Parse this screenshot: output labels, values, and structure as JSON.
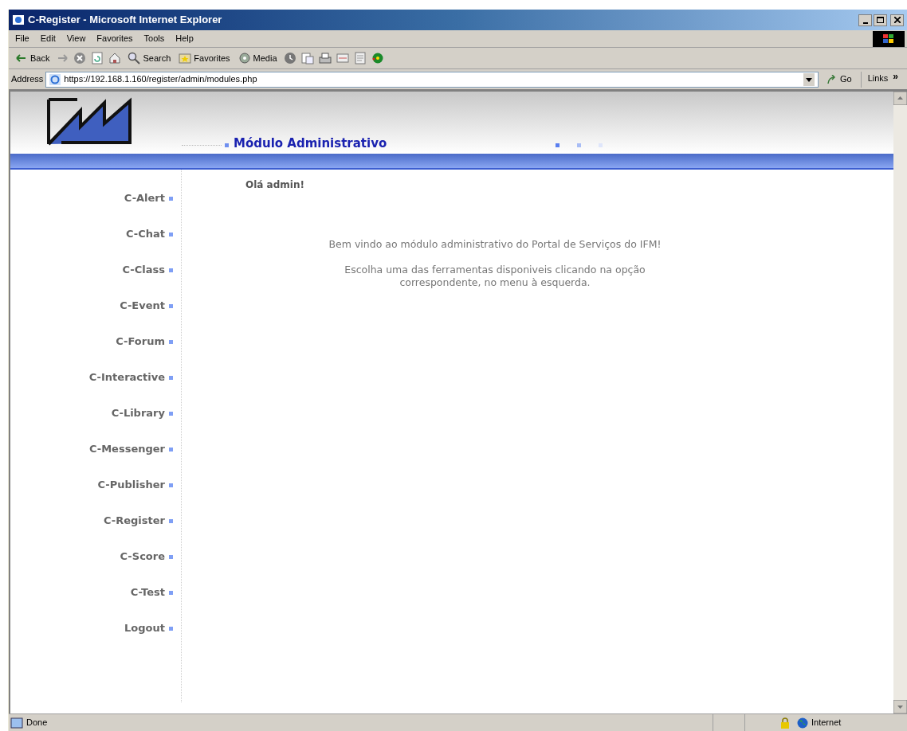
{
  "window": {
    "title": "C-Register - Microsoft Internet Explorer"
  },
  "menu": [
    "File",
    "Edit",
    "View",
    "Favorites",
    "Tools",
    "Help"
  ],
  "toolbar": [
    {
      "kind": "back",
      "label": "Back"
    },
    {
      "kind": "forward"
    },
    {
      "kind": "stop"
    },
    {
      "kind": "refresh"
    },
    {
      "kind": "home"
    },
    {
      "kind": "search",
      "label": "Search"
    },
    {
      "kind": "favorites",
      "label": "Favorites"
    },
    {
      "kind": "media",
      "label": "Media"
    },
    {
      "kind": "history"
    },
    {
      "kind": "mail"
    },
    {
      "kind": "print"
    },
    {
      "kind": "edit"
    },
    {
      "kind": "discuss"
    },
    {
      "kind": "messenger"
    }
  ],
  "address": {
    "label": "Address",
    "value": "https://192.168.1.160/register/admin/modules.php",
    "go": "Go",
    "links": "Links",
    "more": "»"
  },
  "page": {
    "header": "Módulo Administrativo",
    "greeting": "Olá admin!",
    "welcome": [
      "Bem vindo ao módulo administrativo do Portal de Serviços do IFM!",
      "Escolha uma das ferramentas disponiveis clicando na opção correspondente, no menu à esquerda."
    ],
    "menu": [
      "C-Alert",
      "C-Chat",
      "C-Class",
      "C-Event",
      "C-Forum",
      "C-Interactive",
      "C-Library",
      "C-Messenger",
      "C-Publisher",
      "C-Register",
      "C-Score",
      "C-Test",
      "Logout"
    ]
  },
  "status_bar": {
    "text": "Done",
    "zone": "Internet"
  }
}
